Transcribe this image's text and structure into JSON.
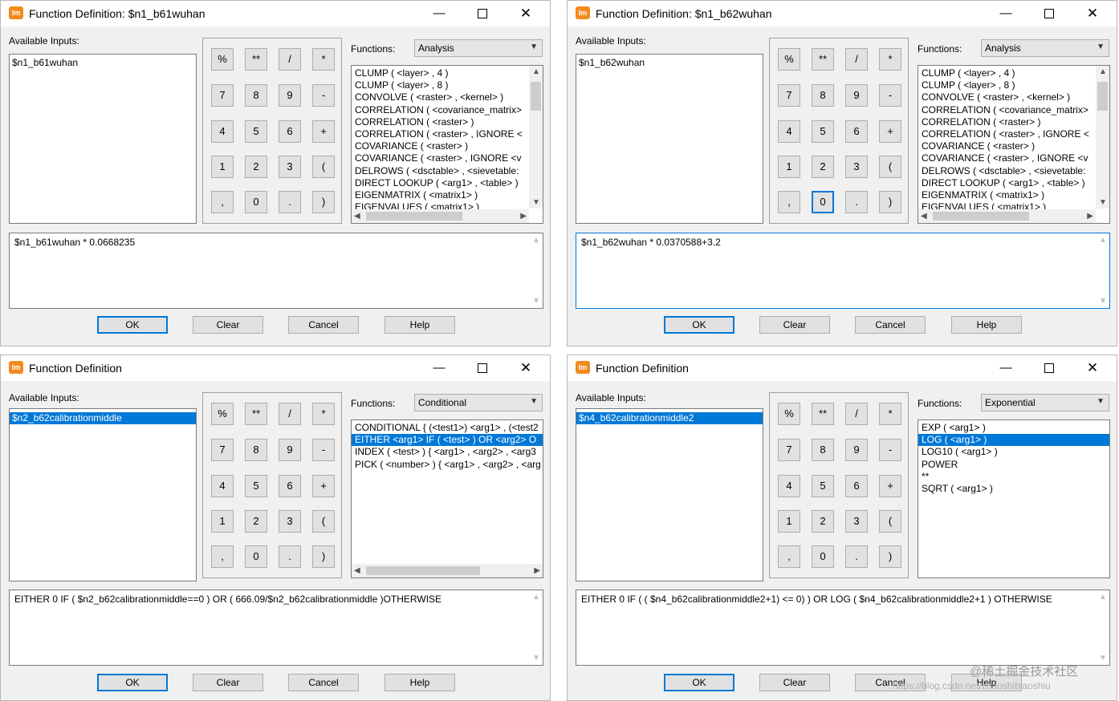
{
  "colors": {
    "accent": "#0078d7",
    "app_icon": "#f28a1e",
    "window_bg": "#f0f0f0"
  },
  "window_controls": {
    "minimize": "—",
    "close": "✕"
  },
  "common": {
    "app_icon_text": "Im",
    "available_inputs_label": "Available Inputs:",
    "functions_label": "Functions:",
    "ok": "OK",
    "clear": "Clear",
    "cancel": "Cancel",
    "help": "Help",
    "keys": [
      "%",
      "**",
      "/",
      "*",
      "7",
      "8",
      "9",
      "-",
      "4",
      "5",
      "6",
      "+",
      "1",
      "2",
      "3",
      "(",
      ",",
      "0",
      ".",
      ")"
    ]
  },
  "windows": [
    {
      "title": "Function Definition:  $n1_b61wuhan",
      "input": "$n1_b61wuhan",
      "input_selected": false,
      "function_category": "Analysis",
      "functions": [
        "CLUMP ( <layer> , 4 )",
        "CLUMP ( <layer> , 8 )",
        "CONVOLVE ( <raster> , <kernel> )",
        "CORRELATION ( <covariance_matrix>",
        "CORRELATION ( <raster> )",
        "CORRELATION ( <raster> , IGNORE <",
        "COVARIANCE ( <raster> )",
        "COVARIANCE ( <raster> , IGNORE <v",
        "DELROWS ( <dsctable> , <sievetable:",
        "DIRECT LOOKUP ( <arg1> , <table> )",
        "EIGENMATRIX ( <matrix1> )",
        "EIGENVALUES ( <matrix1> )"
      ],
      "selected_function": -1,
      "expression": "$n1_b61wuhan * 0.0668235"
    },
    {
      "title": "Function Definition:  $n1_b62wuhan",
      "input": "$n1_b62wuhan",
      "input_selected": false,
      "function_category": "Analysis",
      "functions": [
        "CLUMP ( <layer> , 4 )",
        "CLUMP ( <layer> , 8 )",
        "CONVOLVE ( <raster> , <kernel> )",
        "CORRELATION ( <covariance_matrix>",
        "CORRELATION ( <raster> )",
        "CORRELATION ( <raster> , IGNORE <",
        "COVARIANCE ( <raster> )",
        "COVARIANCE ( <raster> , IGNORE <v",
        "DELROWS ( <dsctable> , <sievetable:",
        "DIRECT LOOKUP ( <arg1> , <table> )",
        "EIGENMATRIX ( <matrix1> )",
        "EIGENVALUES ( <matrix1> )"
      ],
      "selected_function": -1,
      "expression": "$n1_b62wuhan * 0.0370588+3.2"
    },
    {
      "title": "Function Definition",
      "input": "$n2_b62calibrationmiddle",
      "input_selected": true,
      "function_category": "Conditional",
      "functions": [
        "CONDITIONAL { (<test1>) <arg1> , (<test2",
        "EITHER <arg1> IF ( <test> ) OR <arg2> O",
        "INDEX ( <test> ) { <arg1> , <arg2> , <arg3",
        "PICK ( <number> ) { <arg1> , <arg2> , <arg"
      ],
      "selected_function": 1,
      "expression": "EITHER 0 IF ( $n2_b62calibrationmiddle==0 ) OR ( 666.09/$n2_b62calibrationmiddle )OTHERWISE"
    },
    {
      "title": "Function Definition",
      "input": "$n4_b62calibrationmiddle2",
      "input_selected": true,
      "function_category": "Exponential",
      "functions": [
        "EXP ( <arg1> )",
        "LOG ( <arg1> )",
        "LOG10 ( <arg1> )",
        "POWER",
        "**",
        "SQRT ( <arg1> )"
      ],
      "selected_function": 1,
      "expression": "EITHER 0 IF ( ( $n4_b62calibrationmiddle2+1) <= 0) ) OR LOG ( $n4_b62calibrationmiddle2+1 ) OTHERWISE"
    }
  ],
  "watermark": {
    "main": "@稀土掘金技术社区",
    "sub": "https://blog.csdn.net/zhaoshibiaoshiu"
  }
}
